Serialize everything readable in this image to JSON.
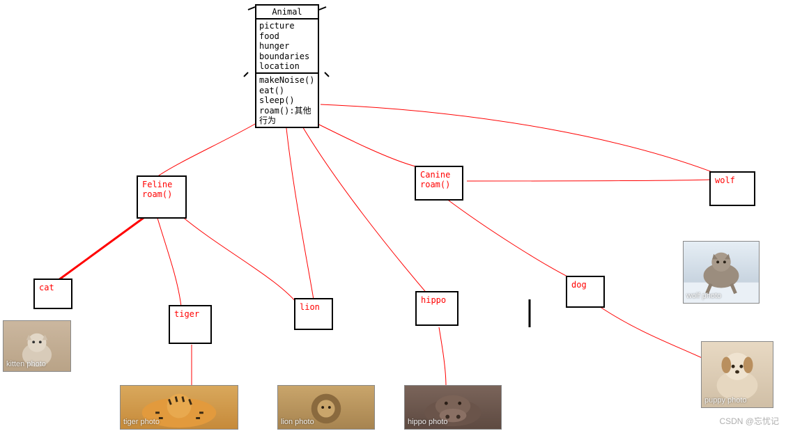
{
  "uml": {
    "animal": {
      "title": "Animal",
      "attributes": [
        "picture",
        "food",
        "hunger",
        "boundaries",
        "location"
      ],
      "methods": [
        "makeNoise()",
        "eat()",
        "sleep()",
        "roam():其他行为"
      ]
    }
  },
  "nodes": {
    "feline": {
      "lines": [
        "Feline",
        "",
        "roam()"
      ]
    },
    "canine": {
      "lines": [
        "Canine",
        "roam()"
      ]
    },
    "wolf": {
      "lines": [
        "wolf"
      ]
    },
    "cat": {
      "lines": [
        "cat"
      ]
    },
    "tiger": {
      "lines": [
        "tiger"
      ]
    },
    "lion": {
      "lines": [
        "lion"
      ]
    },
    "hippo": {
      "lines": [
        "hippo"
      ]
    },
    "dog": {
      "lines": [
        "dog"
      ]
    }
  },
  "photos": {
    "cat": "kitten photo",
    "tiger": "tiger photo",
    "lion": "lion photo",
    "hippo": "hippo photo",
    "wolf": "wolf photo",
    "dog": "puppy photo"
  },
  "watermark": "CSDN @忘忧记"
}
